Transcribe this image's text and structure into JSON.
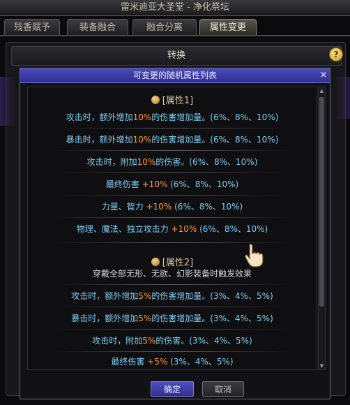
{
  "window": {
    "title": "雷米迪亚大圣堂 - 净化祭坛"
  },
  "tabs": [
    {
      "label": "残香赋予"
    },
    {
      "label": "装备融合"
    },
    {
      "label": "融合分离"
    },
    {
      "label": "属性变更",
      "active": true
    }
  ],
  "convert_bar": {
    "label": "转换",
    "help": "?"
  },
  "popup": {
    "title": "可变更的随机属性列表",
    "close": "×",
    "sections": [
      {
        "header": "[属性1]",
        "rows": [
          {
            "pre": "攻击时，额外增加",
            "pct": "10%",
            "post": "的伤害增加量。(6%、8%、10%)"
          },
          {
            "pre": "暴击时，额外增加",
            "pct": "10%",
            "post": "的伤害增加量。(6%、8%、10%)"
          },
          {
            "pre": "攻击时，附加",
            "pct": "10%",
            "post": "的伤害。(6%、8%、10%)"
          },
          {
            "pre": "最终伤害 ",
            "pct": "+10%",
            "post": " (6%、8%、10%)"
          },
          {
            "pre": "力量、智力 ",
            "pct": "+10%",
            "post": " (6%、8%、10%)"
          },
          {
            "pre": "物理、魔法、独立攻击力 ",
            "pct": "+10%",
            "post": " (6%、8%、10%)"
          }
        ]
      },
      {
        "header": "[属性2]",
        "note": "穿戴全部无形、无欲、幻影装备时触发效果",
        "rows": [
          {
            "pre": "攻击时，额外增加",
            "pct": "5%",
            "post": "的伤害增加量。(3%、4%、5%)"
          },
          {
            "pre": "暴击时，额外增加",
            "pct": "5%",
            "post": "的伤害增加量。(3%、4%、5%)"
          },
          {
            "pre": "攻击时，附加",
            "pct": "5%",
            "post": "的伤害。(3%、4%、5%)"
          },
          {
            "pre": "最终伤害 ",
            "pct": "+5%",
            "post": " (3%、4%、5%)"
          }
        ]
      }
    ]
  },
  "buttons": {
    "ok": "确定",
    "cancel": "取消"
  },
  "colors": {
    "accent_header": "#3a3aa8",
    "value_highlight": "#ff9b2a",
    "row_text": "#7fcdf0"
  }
}
